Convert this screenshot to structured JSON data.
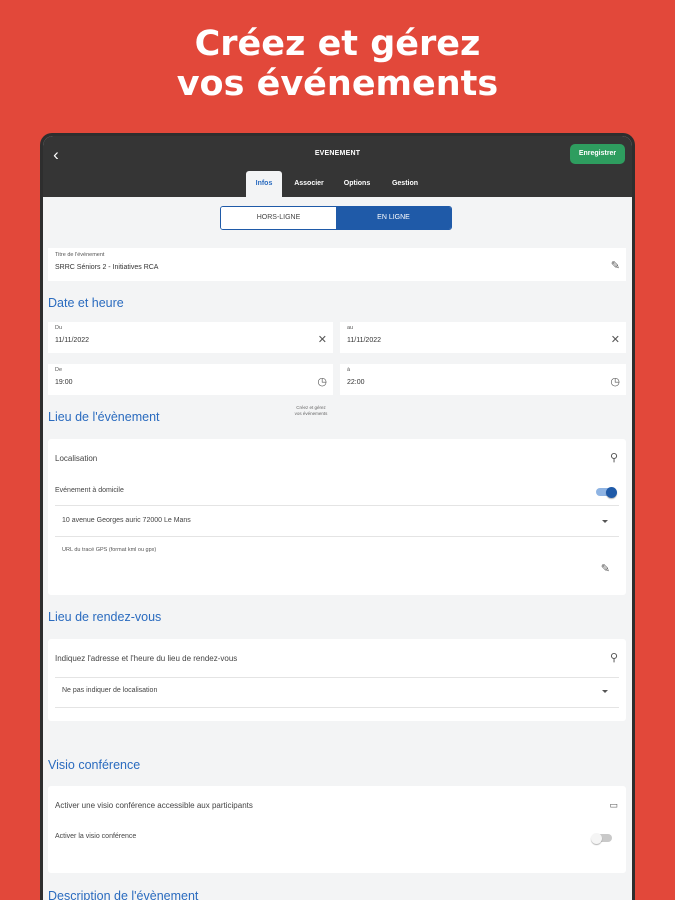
{
  "promo": {
    "line1": "Créez et gérez",
    "line2": "vos événements"
  },
  "header": {
    "title": "EVENEMENT",
    "save_label": "Enregistrer",
    "tabs": [
      {
        "label": "Infos",
        "active": true
      },
      {
        "label": "Associer"
      },
      {
        "label": "Options"
      },
      {
        "label": "Gestion"
      }
    ]
  },
  "mode": {
    "offline_label": "HORS-LIGNE",
    "online_label": "EN LIGNE",
    "selected": "EN LIGNE"
  },
  "event_title": {
    "label": "Titre de l'événement",
    "value": "SRRC Séniors 2 - Initiatives RCA"
  },
  "date_time": {
    "section_title": "Date et heure",
    "from_date": {
      "label": "Du",
      "value": "11/11/2022"
    },
    "to_date": {
      "label": "au",
      "value": "11/11/2022"
    },
    "from_time": {
      "label": "De",
      "value": "19:00"
    },
    "to_time": {
      "label": "à",
      "value": "22:00"
    }
  },
  "overlay_note": {
    "line1": "Créez et gérez",
    "line2": "vos événements"
  },
  "location": {
    "section_title": "Lieu de l'évènement",
    "localisation_label": "Localisation",
    "home_event_label": "Evénement à domicile",
    "home_event_enabled": true,
    "address_value": "10 avenue Georges auric 72000 Le Mans",
    "gps_label": "URL du tracé GPS (format kml ou gpx)",
    "gps_value": ""
  },
  "meeting_point": {
    "section_title": "Lieu de rendez-vous",
    "prompt": "Indiquez l'adresse et l'heure du lieu de rendez-vous",
    "select_value": "Ne pas indiquer de localisation"
  },
  "visio": {
    "section_title": "Visio conférence",
    "prompt": "Activer une visio conférence accessible aux participants",
    "toggle_label": "Activer la visio conférence",
    "enabled": false
  },
  "description": {
    "section_title": "Description de l'évènement"
  },
  "colors": {
    "brand_red": "#e2483a",
    "accent_blue": "#1f5aa8",
    "title_blue": "#2a6bbf",
    "save_green": "#2e9d5f",
    "dark_bar": "#353535"
  }
}
